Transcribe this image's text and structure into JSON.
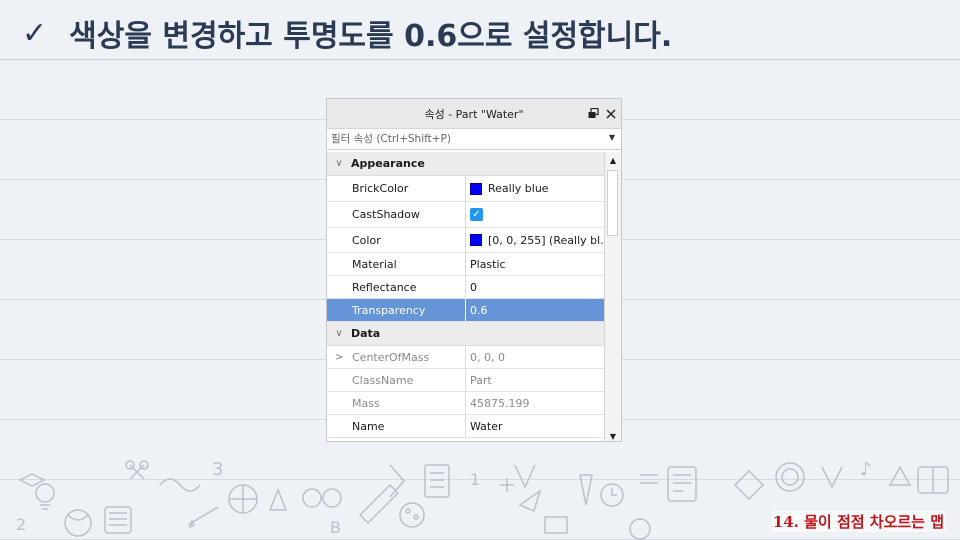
{
  "slide": {
    "title": "색상을 변경하고 투명도를 0.6으로 설정합니다.",
    "footer": "14. 물이 점점 차오르는 맵"
  },
  "panel": {
    "title": "속성 - Part \"Water\"",
    "filter_placeholder": "필터 속성 (Ctrl+Shift+P)",
    "categories": {
      "appearance": "Appearance",
      "data": "Data"
    },
    "appearance_props": [
      {
        "name": "BrickColor",
        "value": "Really blue"
      },
      {
        "name": "CastShadow",
        "value": "true"
      },
      {
        "name": "Color",
        "value": "[0, 0, 255] (Really bl..."
      },
      {
        "name": "Material",
        "value": "Plastic"
      },
      {
        "name": "Reflectance",
        "value": "0"
      },
      {
        "name": "Transparency",
        "value": "0.6"
      }
    ],
    "data_props": [
      {
        "name": "CenterOfMass",
        "value": "0, 0, 0"
      },
      {
        "name": "ClassName",
        "value": "Part"
      },
      {
        "name": "Mass",
        "value": "45875.199"
      },
      {
        "name": "Name",
        "value": "Water"
      }
    ]
  },
  "colors": {
    "swatch": "#0000ff",
    "selected_row": "#6594d8",
    "title_text": "#2b3a55",
    "footer_text": "#c0141b"
  }
}
